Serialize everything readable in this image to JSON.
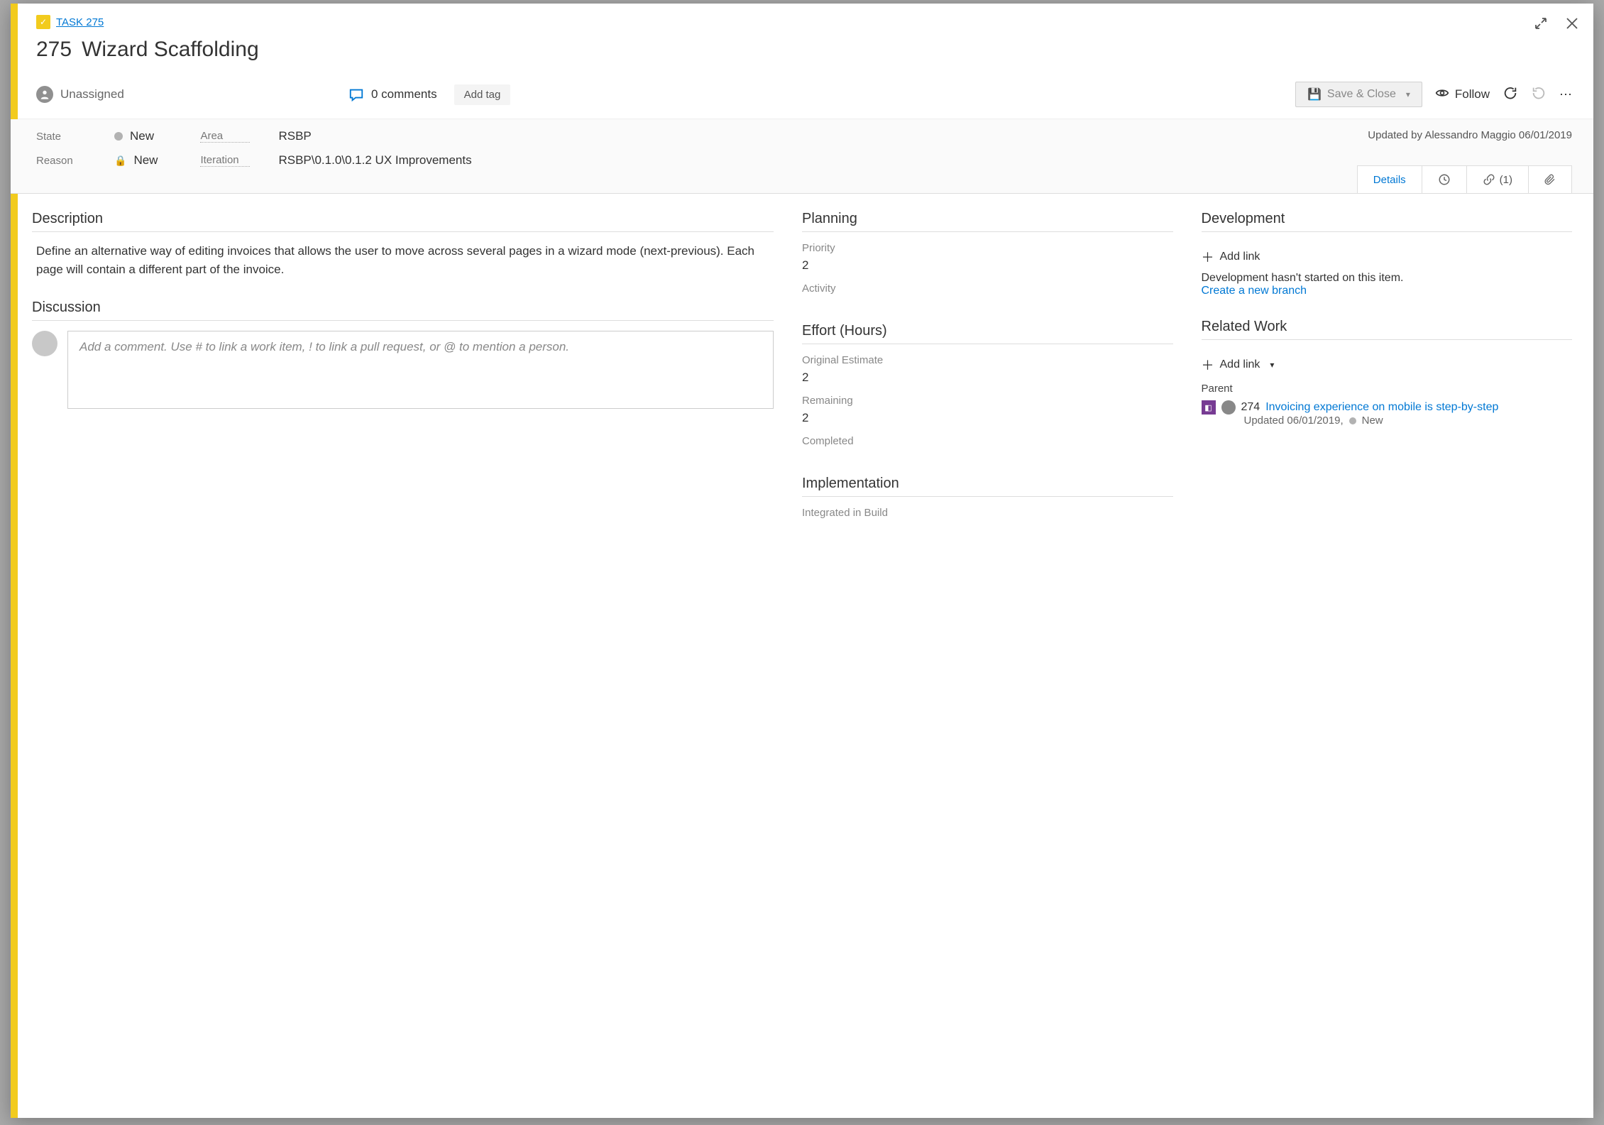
{
  "breadcrumb": {
    "type": "TASK 275"
  },
  "title": {
    "id": "275",
    "name": "Wizard Scaffolding"
  },
  "assigned": "Unassigned",
  "comments": "0 comments",
  "add_tag": "Add tag",
  "save": "Save & Close",
  "follow": "Follow",
  "meta": {
    "state_label": "State",
    "state_value": "New",
    "reason_label": "Reason",
    "reason_value": "New",
    "area_label": "Area",
    "area_value": "RSBP",
    "iteration_label": "Iteration",
    "iteration_value": "RSBP\\0.1.0\\0.1.2 UX Improvements"
  },
  "updated_by": "Updated by Alessandro Maggio 06/01/2019",
  "tabs": {
    "details": "Details",
    "links_count": "(1)"
  },
  "description": {
    "heading": "Description",
    "text": "Define an alternative way of editing invoices that allows the user to move across several pages in a wizard mode (next-previous). Each page will contain a different part of the invoice."
  },
  "discussion": {
    "heading": "Discussion",
    "placeholder": "Add a comment. Use # to link a work item, ! to link a pull request, or @ to mention a person."
  },
  "planning": {
    "heading": "Planning",
    "priority_label": "Priority",
    "priority_value": "2",
    "activity_label": "Activity"
  },
  "effort": {
    "heading": "Effort (Hours)",
    "original_label": "Original Estimate",
    "original_value": "2",
    "remaining_label": "Remaining",
    "remaining_value": "2",
    "completed_label": "Completed"
  },
  "implementation": {
    "heading": "Implementation",
    "integrated_label": "Integrated in Build"
  },
  "development": {
    "heading": "Development",
    "add_link": "Add link",
    "status": "Development hasn't started on this item.",
    "create_branch": "Create a new branch"
  },
  "related": {
    "heading": "Related Work",
    "add_link": "Add link",
    "parent_label": "Parent",
    "item_id": "274",
    "item_title": "Invoicing experience on mobile is step-by-step",
    "item_updated": "Updated 06/01/2019,",
    "item_state": "New"
  }
}
